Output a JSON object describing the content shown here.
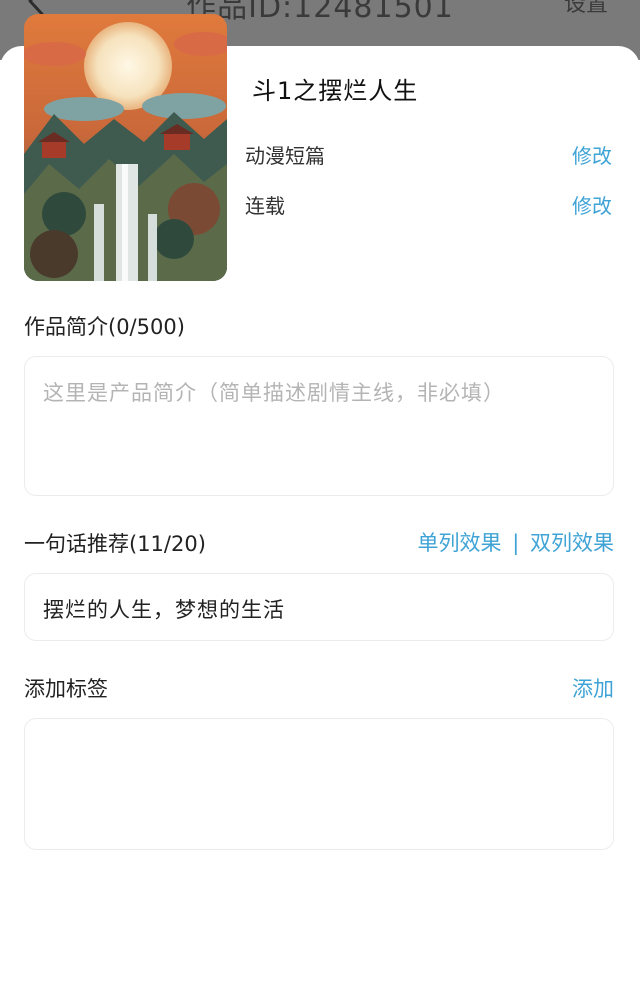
{
  "topbar": {
    "title": "作品ID:12481501",
    "settings_label": "设置"
  },
  "work": {
    "title": "斗1之摆烂人生",
    "category": "动漫短篇",
    "category_action": "修改",
    "status": "连载",
    "status_action": "修改"
  },
  "intro": {
    "label": "作品简介(0/500)",
    "placeholder": "这里是产品简介（简单描述剧情主线，非必填）"
  },
  "recommend": {
    "label": "一句话推荐(11/20)",
    "single_label": "单列效果",
    "separator": "|",
    "double_label": "双列效果",
    "value": "摆烂的人生，梦想的生活"
  },
  "tags": {
    "label": "添加标签",
    "add_label": "添加"
  },
  "colors": {
    "accent": "#3fa3d6",
    "overlay": "#7a7a7a"
  }
}
